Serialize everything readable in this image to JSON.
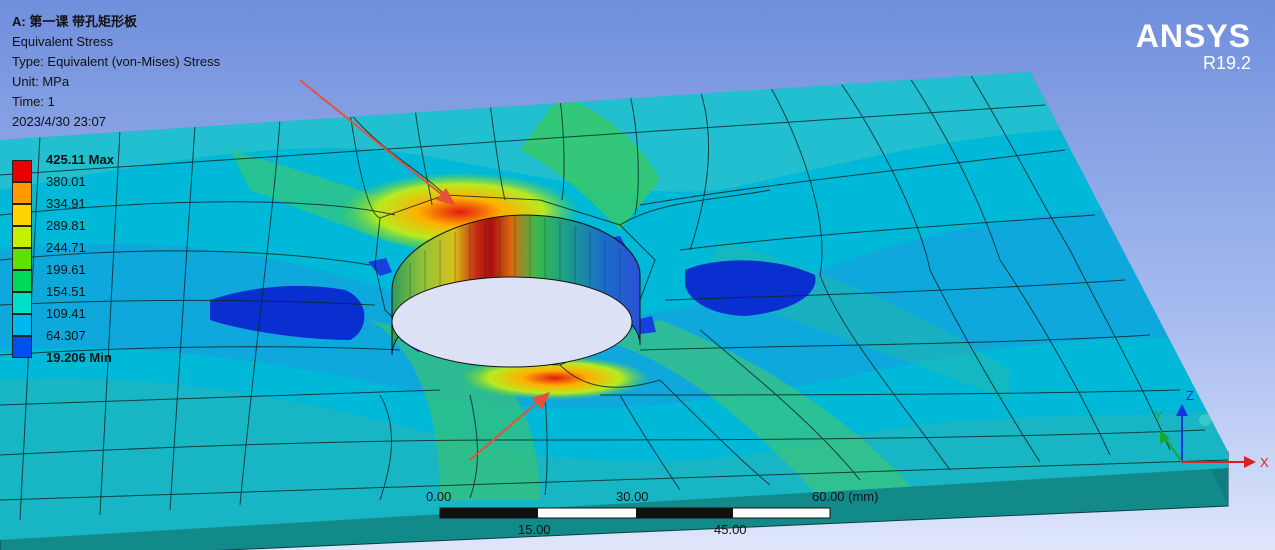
{
  "result_info": {
    "title": "A: 第一课 带孔矩形板",
    "result_name": "Equivalent Stress",
    "type": "Type: Equivalent (von-Mises) Stress",
    "unit": "Unit: MPa",
    "time": "Time: 1",
    "timestamp": "2023/4/30 23:07"
  },
  "brand": {
    "name": "ANSYS",
    "release": "R19.2"
  },
  "legend": {
    "labels": [
      "425.11 Max",
      "380.01",
      "334.91",
      "289.81",
      "244.71",
      "199.61",
      "154.51",
      "109.41",
      "64.307",
      "19.206 Min"
    ],
    "colors": [
      "#e80000",
      "#ff9a00",
      "#ffd400",
      "#c7f000",
      "#5fe000",
      "#00d85a",
      "#00e0c8",
      "#00b8f0",
      "#0050f0"
    ]
  },
  "scale_bar": {
    "top_labels": [
      "0.00",
      "30.00",
      "60.00 (mm)"
    ],
    "bottom_labels": [
      "15.00",
      "45.00"
    ]
  },
  "axes": {
    "x": "X",
    "y": "Y",
    "z": "Z"
  }
}
